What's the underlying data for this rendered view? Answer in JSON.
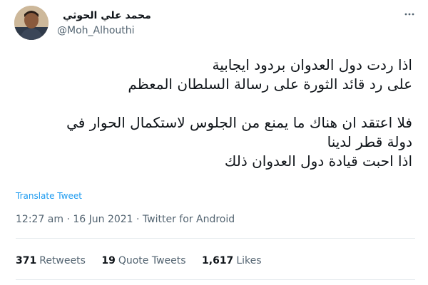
{
  "user": {
    "name": "محمد علي الحوثي",
    "handle": "@Moh_Alhouthi"
  },
  "tweet": {
    "lines": [
      "اذا ردت دول العدوان بردود ايجابية",
      "على رد قائد الثورة على رسالة السلطان المعظم",
      "",
      "فلا اعتقد ان هناك ما يمنع من الجلوس لاستكمال الحوار في",
      "دولة قطر لدينا",
      "اذا احبت قيادة دول العدوان ذلك"
    ],
    "translate_label": "Translate Tweet",
    "timestamp": "12:27 am · 16 Jun 2021 · Twitter for Android"
  },
  "stats": [
    {
      "count": "371",
      "label": "Retweets"
    },
    {
      "count": "19",
      "label": "Quote Tweets"
    },
    {
      "count": "1,617",
      "label": "Likes"
    }
  ],
  "icons": {
    "more": "more-options-icon",
    "avatar": "avatar-photo"
  },
  "colors": {
    "link": "#1d9bf0",
    "secondary": "#536471",
    "text": "#0f1419"
  }
}
